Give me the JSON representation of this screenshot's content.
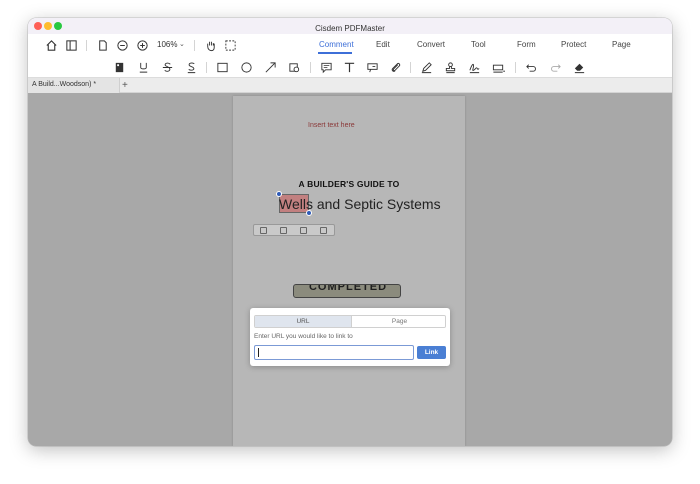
{
  "window": {
    "title": "Cisdem PDFMaster"
  },
  "toolbar": {
    "zoom": "106%"
  },
  "menu": {
    "tabs": [
      {
        "label": "Comment",
        "active": true
      },
      {
        "label": "Edit"
      },
      {
        "label": "Convert"
      },
      {
        "label": "Tool"
      },
      {
        "label": "Form"
      },
      {
        "label": "Protect"
      },
      {
        "label": "Page"
      }
    ]
  },
  "annotation_tools": [
    "text-box-icon",
    "underline-icon",
    "strikethrough-icon",
    "squiggly-icon",
    "rectangle-icon",
    "ellipse-icon",
    "arrow-icon",
    "shape-menu-icon",
    "note-icon",
    "text-icon",
    "callout-icon",
    "attachment-icon",
    "pen-icon",
    "stamp-icon",
    "signature-icon",
    "measure-icon",
    "undo-icon",
    "redo-icon",
    "eraser-icon"
  ],
  "tabs": {
    "document": "A Build...Woodson) *",
    "add": "+"
  },
  "page": {
    "insert_text": "Insert text here",
    "heading": "A BUILDER'S GUIDE TO",
    "subtitle_selected": "Wells",
    "subtitle_rest": " and Septic Systems",
    "stamp": "COMPLETED"
  },
  "link_dialog": {
    "tab_url": "URL",
    "tab_page": "Page",
    "prompt": "Enter URL you would like to link to",
    "input_value": "",
    "button": "Link"
  },
  "colors": {
    "accent": "#3d6fd8",
    "link_button": "#4a7fd4",
    "highlight": "#c66e6e"
  }
}
